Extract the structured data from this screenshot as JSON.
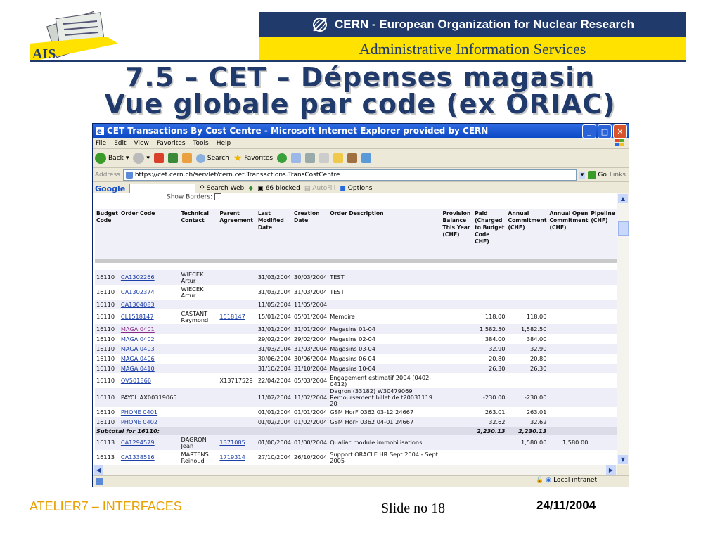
{
  "header": {
    "logo_text": "AIS",
    "org_name": "CERN - European Organization for Nuclear Research",
    "service_name": "Administrative Information Services"
  },
  "slide": {
    "title_line1": "7.5 – CET – Dépenses magasin",
    "title_line2": "Vue globale par code (ex ORIAC)"
  },
  "browser": {
    "title": "CET Transactions By Cost Centre - Microsoft Internet Explorer provided by CERN",
    "menu": [
      "File",
      "Edit",
      "View",
      "Favorites",
      "Tools",
      "Help"
    ],
    "toolbar": {
      "back": "Back",
      "search": "Search",
      "favorites": "Favorites"
    },
    "address_label": "Address",
    "address_url": "https://cet.cern.ch/servlet/cern.cet.Transactions.TransCostCentre",
    "go": "Go",
    "links": "Links",
    "google": {
      "logo": "Google",
      "search_web": "Search Web",
      "blocked": "66 blocked",
      "autofill": "AutoFill",
      "options": "Options"
    },
    "show_borders": "Show Borders:",
    "status_zone": "Local intranet"
  },
  "table": {
    "columns": [
      "Budget Code",
      "Order Code",
      "Technical Contact",
      "Parent Agreement",
      "Last Modified Date",
      "Creation Date",
      "Order Description",
      "Provision Balance This Year (CHF)",
      "Paid (Charged to Budget Code CHF)",
      "Annual Commitment (CHF)",
      "Annual Open Commitment (CHF)",
      "Pipeline (CHF)"
    ],
    "rows": [
      {
        "budget": "16110",
        "order": "CA1302266",
        "contact": "WIECEK Artur",
        "parent": "",
        "modified": "31/03/2004",
        "created": "30/03/2004",
        "desc": "TEST",
        "provision": "",
        "paid": "",
        "annual": "",
        "open": "",
        "pipeline": ""
      },
      {
        "budget": "16110",
        "order": "CA1302374",
        "contact": "WIECEK Artur",
        "parent": "",
        "modified": "31/03/2004",
        "created": "31/03/2004",
        "desc": "TEST",
        "provision": "",
        "paid": "",
        "annual": "",
        "open": "",
        "pipeline": ""
      },
      {
        "budget": "16110",
        "order": "CA1304083",
        "contact": "",
        "parent": "",
        "modified": "11/05/2004",
        "created": "11/05/2004",
        "desc": "",
        "provision": "",
        "paid": "",
        "annual": "",
        "open": "",
        "pipeline": ""
      },
      {
        "budget": "16110",
        "order": "CL1518147",
        "contact": "CASTANT Raymond",
        "parent": "1518147",
        "modified": "15/01/2004",
        "created": "05/01/2004",
        "desc": "Memoire",
        "provision": "",
        "paid": "118.00",
        "annual": "118.00",
        "open": "",
        "pipeline": ""
      },
      {
        "budget": "16110",
        "order": "MAGA 0401",
        "contact": "",
        "parent": "",
        "modified": "31/01/2004",
        "created": "31/01/2004",
        "desc": "Magasins 01-04",
        "provision": "",
        "paid": "1,582.50",
        "annual": "1,582.50",
        "open": "",
        "pipeline": ""
      },
      {
        "budget": "16110",
        "order": "MAGA 0402",
        "contact": "",
        "parent": "",
        "modified": "29/02/2004",
        "created": "29/02/2004",
        "desc": "Magasins 02-04",
        "provision": "",
        "paid": "384.00",
        "annual": "384.00",
        "open": "",
        "pipeline": ""
      },
      {
        "budget": "16110",
        "order": "MAGA 0403",
        "contact": "",
        "parent": "",
        "modified": "31/03/2004",
        "created": "31/03/2004",
        "desc": "Magasins 03-04",
        "provision": "",
        "paid": "32.90",
        "annual": "32.90",
        "open": "",
        "pipeline": ""
      },
      {
        "budget": "16110",
        "order": "MAGA 0406",
        "contact": "",
        "parent": "",
        "modified": "30/06/2004",
        "created": "30/06/2004",
        "desc": "Magasins 06-04",
        "provision": "",
        "paid": "20.80",
        "annual": "20.80",
        "open": "",
        "pipeline": ""
      },
      {
        "budget": "16110",
        "order": "MAGA 0410",
        "contact": "",
        "parent": "",
        "modified": "31/10/2004",
        "created": "31/10/2004",
        "desc": "Magasins 10-04",
        "provision": "",
        "paid": "26.30",
        "annual": "26.30",
        "open": "",
        "pipeline": ""
      },
      {
        "budget": "16110",
        "order": "OV501866",
        "contact": "",
        "parent": "X13717529",
        "modified": "22/04/2004",
        "created": "05/03/2004",
        "desc": "Engagement estimatif 2004 (0402-0412)",
        "provision": "",
        "paid": "",
        "annual": "",
        "open": "",
        "pipeline": ""
      },
      {
        "budget": "16110",
        "order": "PAYCL AX00319065",
        "contact": "",
        "parent": "",
        "modified": "11/02/2004",
        "created": "11/02/2004",
        "desc": "Dagron (33182) W30479069 Remoursement billet de t20031119 20",
        "provision": "",
        "paid": "-230.00",
        "annual": "-230.00",
        "open": "",
        "pipeline": ""
      },
      {
        "budget": "16110",
        "order": "PHONE 0401",
        "contact": "",
        "parent": "",
        "modified": "01/01/2004",
        "created": "01/01/2004",
        "desc": "GSM HorF 0362 03-12 24667",
        "provision": "",
        "paid": "263.01",
        "annual": "263.01",
        "open": "",
        "pipeline": ""
      },
      {
        "budget": "16110",
        "order": "PHONE 0402",
        "contact": "",
        "parent": "",
        "modified": "01/02/2004",
        "created": "01/02/2004",
        "desc": "GSM HorF 0362 04-01 24667",
        "provision": "",
        "paid": "32.62",
        "annual": "32.62",
        "open": "",
        "pipeline": ""
      },
      {
        "subtotal": true,
        "label": "Subtotal for 16110:",
        "paid": "2,230.13",
        "annual": "2,230.13"
      },
      {
        "budget": "16113",
        "order": "CA1294579",
        "contact": "DAGRON Jean",
        "parent": "1371085",
        "modified": "01/00/2004",
        "created": "01/00/2004",
        "desc": "Qualiac module immobilisations",
        "provision": "",
        "paid": "",
        "annual": "1,580.00",
        "open": "1,580.00",
        "pipeline": ""
      },
      {
        "budget": "16113",
        "order": "CA1338516",
        "contact": "MARTENS Reinoud",
        "parent": "1719314",
        "modified": "27/10/2004",
        "created": "26/10/2004",
        "desc": "Support ORACLE HR Sept 2004 - Sept 2005",
        "provision": "",
        "paid": "",
        "annual": "",
        "open": "",
        "pipeline": ""
      }
    ]
  },
  "footer": {
    "left": "ATELIER7 – INTERFACES",
    "center": "Slide no 18",
    "right": "24/11/2004"
  },
  "colors": {
    "navy": "#1f3a6b",
    "yellow": "#ffe200",
    "footer_orange": "#e8a100",
    "link": "#1c3fa8"
  }
}
